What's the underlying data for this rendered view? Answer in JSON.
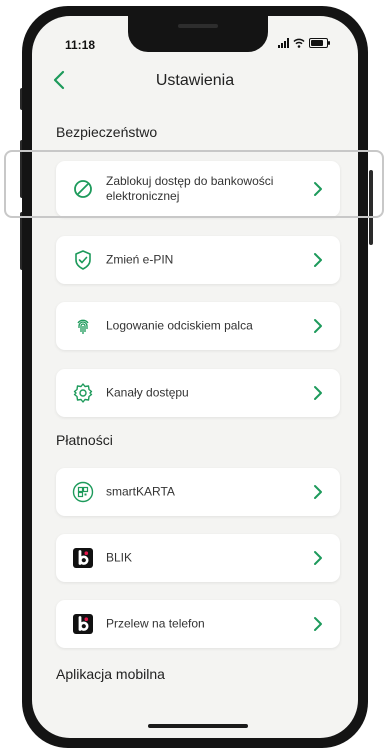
{
  "status": {
    "time": "11:18"
  },
  "header": {
    "title": "Ustawienia"
  },
  "sections": {
    "security": "Bezpieczeństwo",
    "payments": "Płatności",
    "mobile_app": "Aplikacja mobilna"
  },
  "items": {
    "block": "Zablokuj dostęp do bankowości elektronicznej",
    "change_pin": "Zmień e-PIN",
    "fingerprint": "Logowanie odciskiem palca",
    "channels": "Kanały dostępu",
    "smartkarta": "smartKARTA",
    "blik": "BLIK",
    "phone_transfer": "Przelew na telefon"
  },
  "colors": {
    "accent": "#1d9a5b",
    "background": "#f4f4f2"
  },
  "icons": {
    "block": "prohibited-icon",
    "change_pin": "shield-check-icon",
    "fingerprint": "fingerprint-icon",
    "channels": "gear-icon",
    "smartkarta": "qr-card-icon",
    "blik": "blik-logo-icon",
    "phone_transfer": "blik-logo-icon"
  }
}
